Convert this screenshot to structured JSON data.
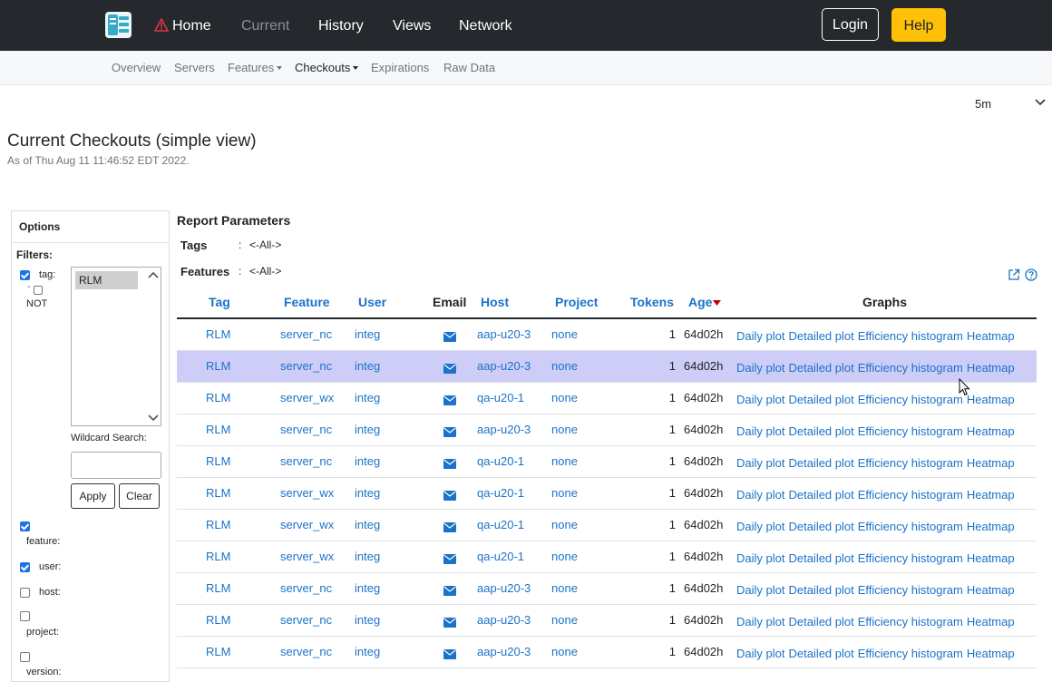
{
  "navbar": {
    "home": "Home",
    "current": "Current",
    "history": "History",
    "views": "Views",
    "network": "Network",
    "login": "Login",
    "help": "Help"
  },
  "subnav": {
    "overview": "Overview",
    "servers": "Servers",
    "features": "Features",
    "checkouts": "Checkouts",
    "expirations": "Expirations",
    "raw_data": "Raw Data"
  },
  "refresh": {
    "value": "5m"
  },
  "page": {
    "title": "Current Checkouts (simple view)",
    "subtitle": "As of Thu Aug 11 11:46:52 EDT 2022."
  },
  "options": {
    "title": "Options",
    "filters_label": "Filters:",
    "tag_label": "tag:",
    "not_label": "NOT",
    "tag_options": [
      "RLM"
    ],
    "wildcard_label": "Wildcard Search:",
    "wildcard_value": "",
    "apply": "Apply",
    "clear": "Clear",
    "feature_label": "feature:",
    "user_label": "user:",
    "host_label": "host:",
    "project_label": "project:",
    "version_label": "version:"
  },
  "report": {
    "title": "Report Parameters",
    "tags_key": "Tags",
    "tags_val": "<-All->",
    "features_key": "Features",
    "features_val": "<-All->",
    "sep": ":"
  },
  "table": {
    "headers": {
      "tag": "Tag",
      "feature": "Feature",
      "user": "User",
      "email": "Email",
      "host": "Host",
      "project": "Project",
      "tokens": "Tokens",
      "age": "Age",
      "graphs": "Graphs"
    },
    "graph_links": {
      "daily": "Daily plot",
      "detailed": "Detailed plot",
      "efficiency": "Efficiency histogram",
      "heatmap": "Heatmap"
    },
    "rows": [
      {
        "tag": "RLM",
        "feature": "server_nc",
        "user": "integ",
        "host": "aap-u20-3",
        "project": "none",
        "tokens": "1",
        "age": "64d02h"
      },
      {
        "tag": "RLM",
        "feature": "server_nc",
        "user": "integ",
        "host": "aap-u20-3",
        "project": "none",
        "tokens": "1",
        "age": "64d02h"
      },
      {
        "tag": "RLM",
        "feature": "server_wx",
        "user": "integ",
        "host": "qa-u20-1",
        "project": "none",
        "tokens": "1",
        "age": "64d02h"
      },
      {
        "tag": "RLM",
        "feature": "server_nc",
        "user": "integ",
        "host": "aap-u20-3",
        "project": "none",
        "tokens": "1",
        "age": "64d02h"
      },
      {
        "tag": "RLM",
        "feature": "server_nc",
        "user": "integ",
        "host": "qa-u20-1",
        "project": "none",
        "tokens": "1",
        "age": "64d02h"
      },
      {
        "tag": "RLM",
        "feature": "server_wx",
        "user": "integ",
        "host": "qa-u20-1",
        "project": "none",
        "tokens": "1",
        "age": "64d02h"
      },
      {
        "tag": "RLM",
        "feature": "server_wx",
        "user": "integ",
        "host": "qa-u20-1",
        "project": "none",
        "tokens": "1",
        "age": "64d02h"
      },
      {
        "tag": "RLM",
        "feature": "server_wx",
        "user": "integ",
        "host": "qa-u20-1",
        "project": "none",
        "tokens": "1",
        "age": "64d02h"
      },
      {
        "tag": "RLM",
        "feature": "server_nc",
        "user": "integ",
        "host": "aap-u20-3",
        "project": "none",
        "tokens": "1",
        "age": "64d02h"
      },
      {
        "tag": "RLM",
        "feature": "server_nc",
        "user": "integ",
        "host": "aap-u20-3",
        "project": "none",
        "tokens": "1",
        "age": "64d02h"
      },
      {
        "tag": "RLM",
        "feature": "server_nc",
        "user": "integ",
        "host": "aap-u20-3",
        "project": "none",
        "tokens": "1",
        "age": "64d02h"
      }
    ],
    "highlight_row": 1
  },
  "colors": {
    "navbar_bg": "#25282c",
    "link": "#1a73c8",
    "help_button": "#ffc107",
    "row_highlight": "#cdcdf7",
    "warning_red": "#dc3545"
  }
}
